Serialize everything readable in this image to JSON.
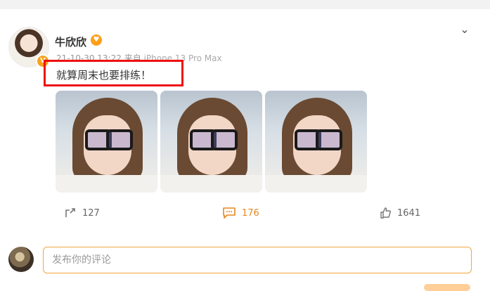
{
  "post": {
    "author": "牛欣欣",
    "meta": {
      "time": "21-10-30 13:22",
      "source_prefix": "来自",
      "device": "iPhone 13 Pro Max"
    },
    "text": "就算周末也要排练！",
    "images": [
      {
        "name": "photo-1"
      },
      {
        "name": "photo-2"
      },
      {
        "name": "photo-3"
      }
    ],
    "stats": {
      "reposts": "127",
      "comments": "176",
      "likes": "1641"
    }
  },
  "comment_box": {
    "placeholder": "发布你的评论"
  },
  "icons": {
    "expand": "chevron-down-icon",
    "repost": "share-icon",
    "comment": "comment-icon",
    "like": "thumbs-up-icon"
  },
  "colors": {
    "accent": "#e8871e",
    "highlight": "#e11111",
    "input_border": "#f3a640"
  }
}
